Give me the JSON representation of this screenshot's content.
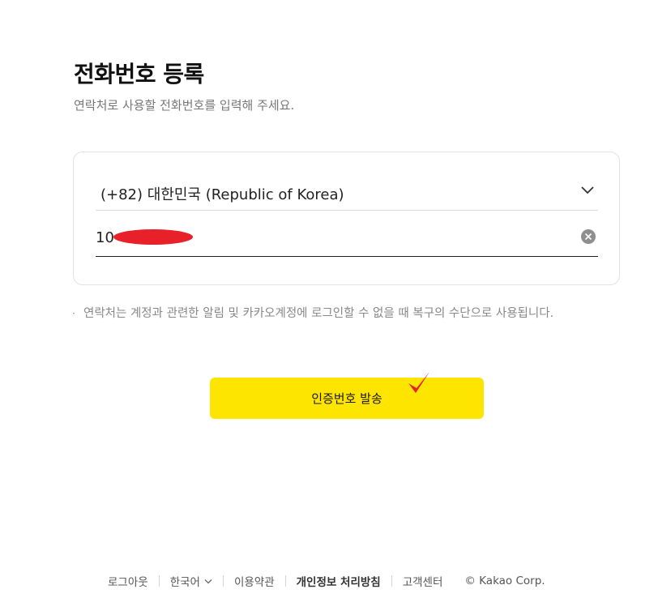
{
  "header": {
    "title": "전화번호 등록",
    "subtitle": "연락처로 사용할 전화번호를 입력해 주세요."
  },
  "form": {
    "country_label": "(+82) 대한민국 (Republic of Korea)",
    "phone_value": "10"
  },
  "notice": {
    "bullet": "·",
    "text": "연락처는 계정과 관련한 알림 및 카카오계정에 로그인할 수 없을 때 복구의 수단으로 사용됩니다."
  },
  "actions": {
    "send_label": "인증번호 발송"
  },
  "footer": {
    "logout": "로그아웃",
    "language": "한국어",
    "terms": "이용약관",
    "privacy": "개인정보 처리방침",
    "support": "고객센터",
    "copyright": "© Kakao Corp."
  },
  "colors": {
    "accent": "#fee500",
    "annotation_red": "#e8202a"
  },
  "icons": {
    "country_dropdown": "chevron-down-icon",
    "clear_input": "clear-icon",
    "language_dropdown": "chevron-down-icon",
    "annotation": "checkmark-icon"
  }
}
